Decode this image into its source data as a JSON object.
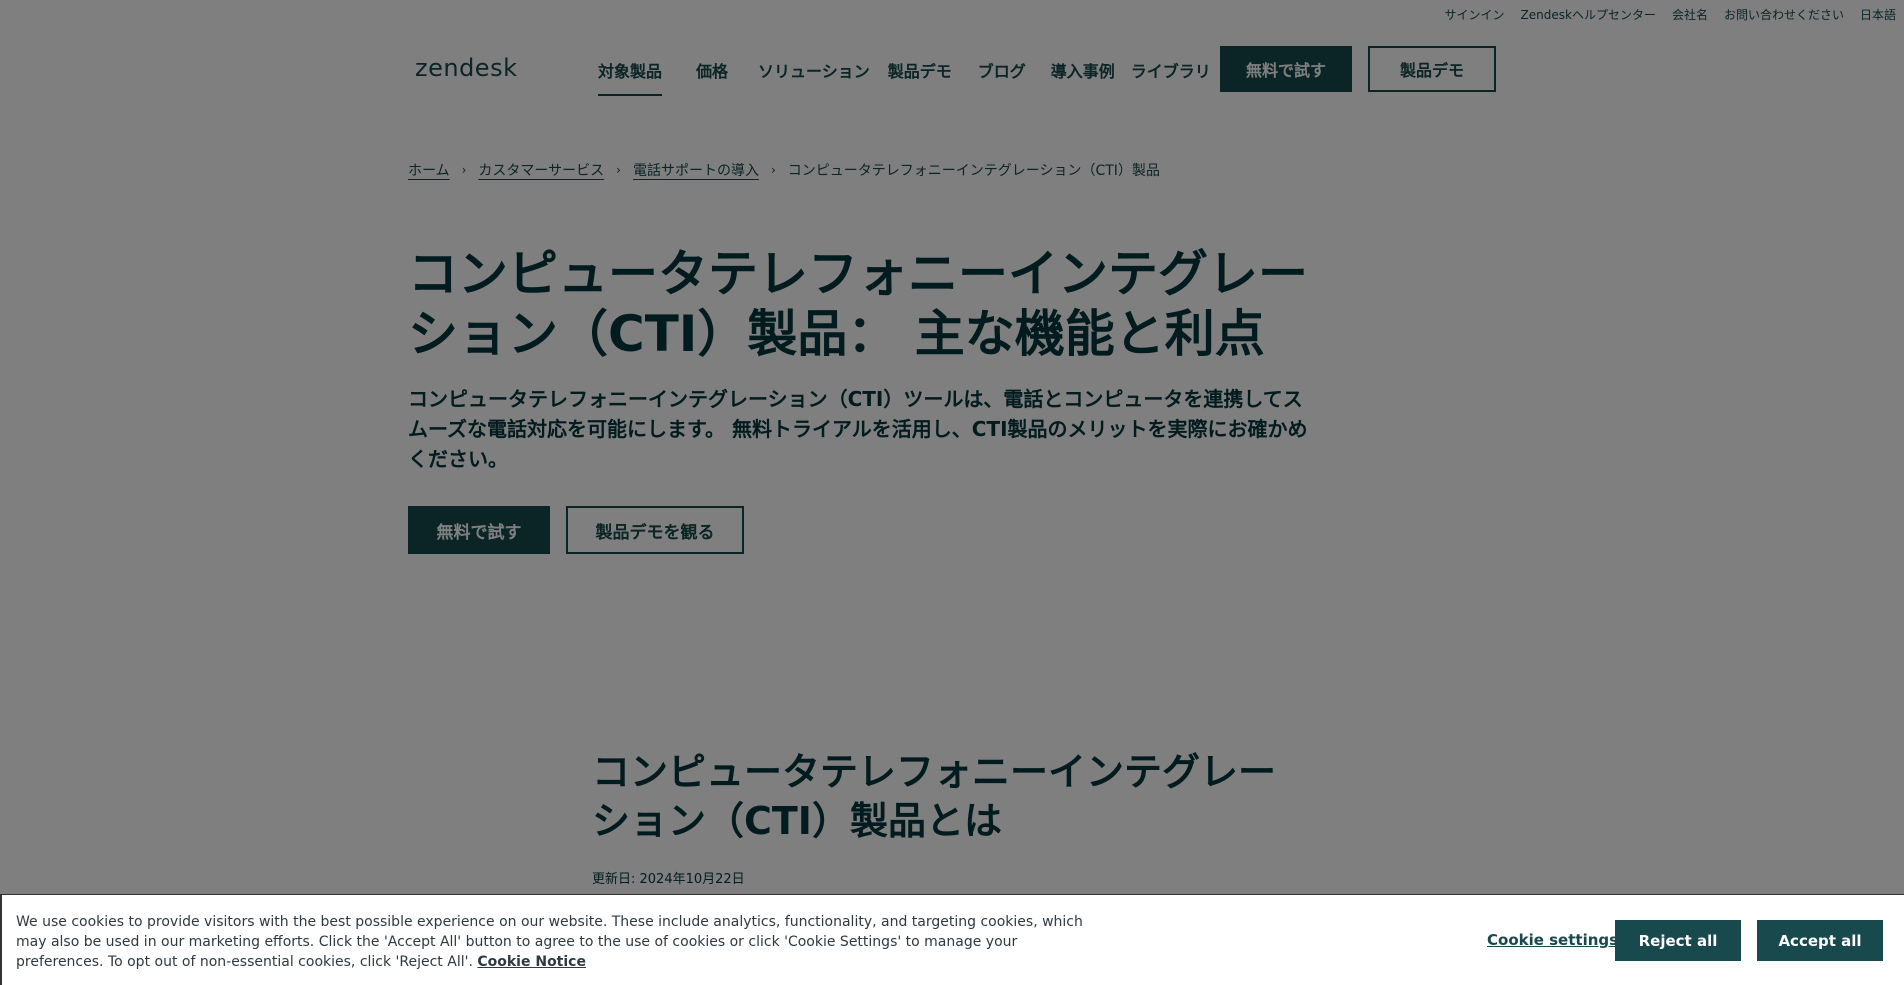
{
  "utility": {
    "signin": "サインイン",
    "help_center": "Zendeskヘルプセンター",
    "company": "会社名",
    "contact": "お問い合わせください",
    "language": "日本語"
  },
  "header": {
    "logo": "zendesk",
    "nav": [
      "対象製品",
      "価格",
      "ソリューション",
      "製品デモ",
      "ブログ",
      "導入事例",
      "ライブラリ"
    ],
    "trial_button": "無料で試す",
    "demo_button": "製品デモ"
  },
  "breadcrumb": {
    "items": [
      "ホーム",
      "カスタマーサービス",
      "電話サポートの導入"
    ],
    "current": "コンピュータテレフォニーインテグレーション（CTI）製品",
    "separator": "›"
  },
  "hero": {
    "title_line1": "コンピュータテレフォニーインテグレー",
    "title_line2": "ション（CTI）製品： 主な機能と利点",
    "desc_line1": "コンピュータテレフォニーインテグレーション（CTI）ツールは、電話とコンピュータを連携してス",
    "desc_line2": "ムーズな電話対応を可能にします。 無料トライアルを活用し、CTI製品のメリットを実際にお確かめ",
    "desc_line3": "ください。",
    "trial_button": "無料で試す",
    "demo_button": "製品デモを観る"
  },
  "section": {
    "title_line1": "コンピュータテレフォニーインテグレー",
    "title_line2": "ション（CTI）製品とは",
    "updated": "更新日: 2024年10月22日"
  },
  "cookie": {
    "text": "We use cookies to provide visitors with the best possible experience on our website. These include analytics, functionality, and targeting cookies, which may also be used in our marketing efforts. Click the 'Accept All' button to agree to the use of cookies or click 'Cookie Settings' to manage your preferences. To opt out of non-essential cookies, click 'Reject All'.",
    "notice_link": "Cookie Notice",
    "settings": "Cookie settings",
    "reject": "Reject all",
    "accept": "Accept all"
  },
  "colors": {
    "brand": "#17494d",
    "heading": "#03363d",
    "overlay": "rgba(0,0,0,0.5)"
  }
}
